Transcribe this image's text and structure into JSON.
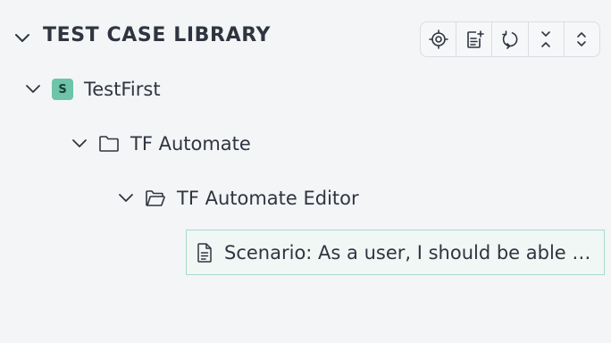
{
  "header": {
    "title": "TEST CASE LIBRARY",
    "expanded_icon": "chevron-down-icon"
  },
  "toolbar": {
    "buttons": [
      {
        "name": "locate",
        "icon": "crosshair-icon"
      },
      {
        "name": "add-test-case",
        "icon": "document-add-icon"
      },
      {
        "name": "refresh",
        "icon": "refresh-icon"
      },
      {
        "name": "collapse-all",
        "icon": "collapse-all-icon"
      },
      {
        "name": "expand-all",
        "icon": "expand-all-icon"
      }
    ]
  },
  "tree": {
    "project": {
      "badge": "S",
      "label": "TestFirst",
      "badge_color": "#6dc4a8"
    },
    "folder": {
      "label": "TF Automate"
    },
    "subfolder": {
      "label": "TF Automate Editor"
    },
    "scenario": {
      "label": "Scenario: As a user, I should be able to access the editor",
      "selected": true
    }
  },
  "colors": {
    "background": "#f4f5f7",
    "text": "#2f3540",
    "accent": "#6dc4a8",
    "selection_border": "#a8dcc8",
    "selection_bg": "#f0f7f5"
  }
}
